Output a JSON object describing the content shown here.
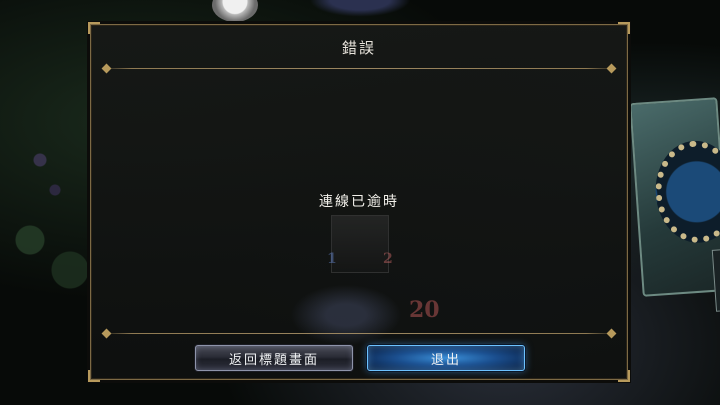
{
  "dialog": {
    "title": "錯誤",
    "message": "連線已逾時"
  },
  "buttons": {
    "return_title": "返回標題畫面",
    "exit": "退出"
  },
  "background": {
    "card_left_value": "1",
    "card_right_value": "2",
    "life_value": "20"
  },
  "colors": {
    "dialog_border": "#7d6a45",
    "primary_button": "#1b4f8f",
    "secondary_button": "#2a2c36"
  }
}
